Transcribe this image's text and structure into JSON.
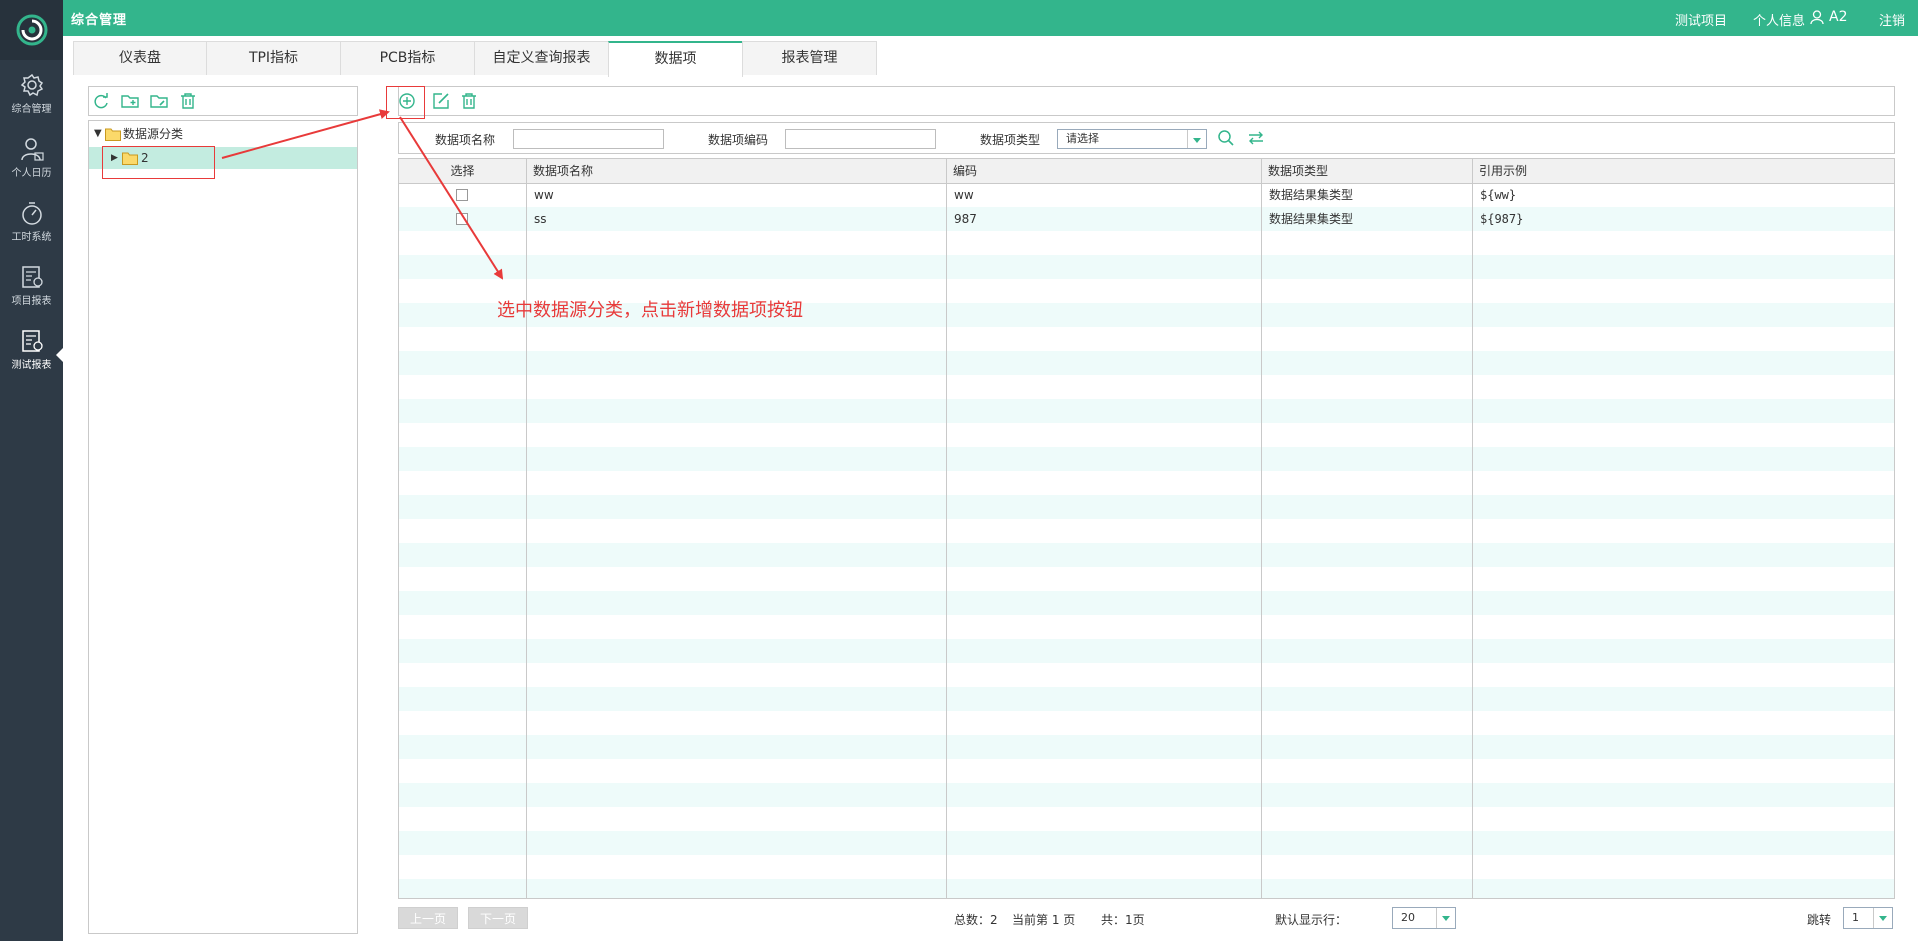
{
  "header": {
    "app_title": "综合管理",
    "links": {
      "test_project": "测试项目",
      "profile": "个人信息",
      "user": "A2",
      "logout": "注销"
    }
  },
  "sidebar": {
    "items": [
      {
        "label": "综合管理",
        "icon": "gear-icon"
      },
      {
        "label": "个人日历",
        "icon": "user-icon"
      },
      {
        "label": "工时系统",
        "icon": "stopwatch-icon"
      },
      {
        "label": "项目报表",
        "icon": "report-icon"
      },
      {
        "label": "测试报表",
        "icon": "test-report-icon",
        "active": true
      }
    ]
  },
  "tabs": [
    {
      "label": "仪表盘"
    },
    {
      "label": "TPI指标"
    },
    {
      "label": "PCB指标"
    },
    {
      "label": "自定义查询报表"
    },
    {
      "label": "数据项",
      "active": true
    },
    {
      "label": "报表管理"
    }
  ],
  "tree": {
    "root_label": "数据源分类",
    "child_label": "2"
  },
  "search": {
    "name_label": "数据项名称",
    "name_value": "",
    "code_label": "数据项编码",
    "code_value": "",
    "type_label": "数据项类型",
    "type_value": "请选择"
  },
  "grid": {
    "columns": [
      "选择",
      "数据项名称",
      "编码",
      "数据项类型",
      "引用示例"
    ],
    "rows": [
      {
        "name": "ww",
        "code": "ww",
        "type": "数据结果集类型",
        "example": "${ww}"
      },
      {
        "name": "ss",
        "code": "987",
        "type": "数据结果集类型",
        "example": "${987}"
      }
    ]
  },
  "annotation": {
    "text": "选中数据源分类，点击新增数据项按钮",
    "color": "#e83a3a"
  },
  "footer": {
    "prev_label": "上一页",
    "next_label": "下一页",
    "total_text": "总数：2",
    "current_text": "当前第 1 页",
    "pages_text": "共：1页",
    "page_size_label": "默认显示行：",
    "page_size_value": "20",
    "jump_label": "跳转",
    "jump_value": "1"
  },
  "colors": {
    "accent": "#33b58c",
    "sidebar": "#2e3a46",
    "row_stripe": "#eefbfa",
    "tree_selected": "#c3ece0"
  }
}
